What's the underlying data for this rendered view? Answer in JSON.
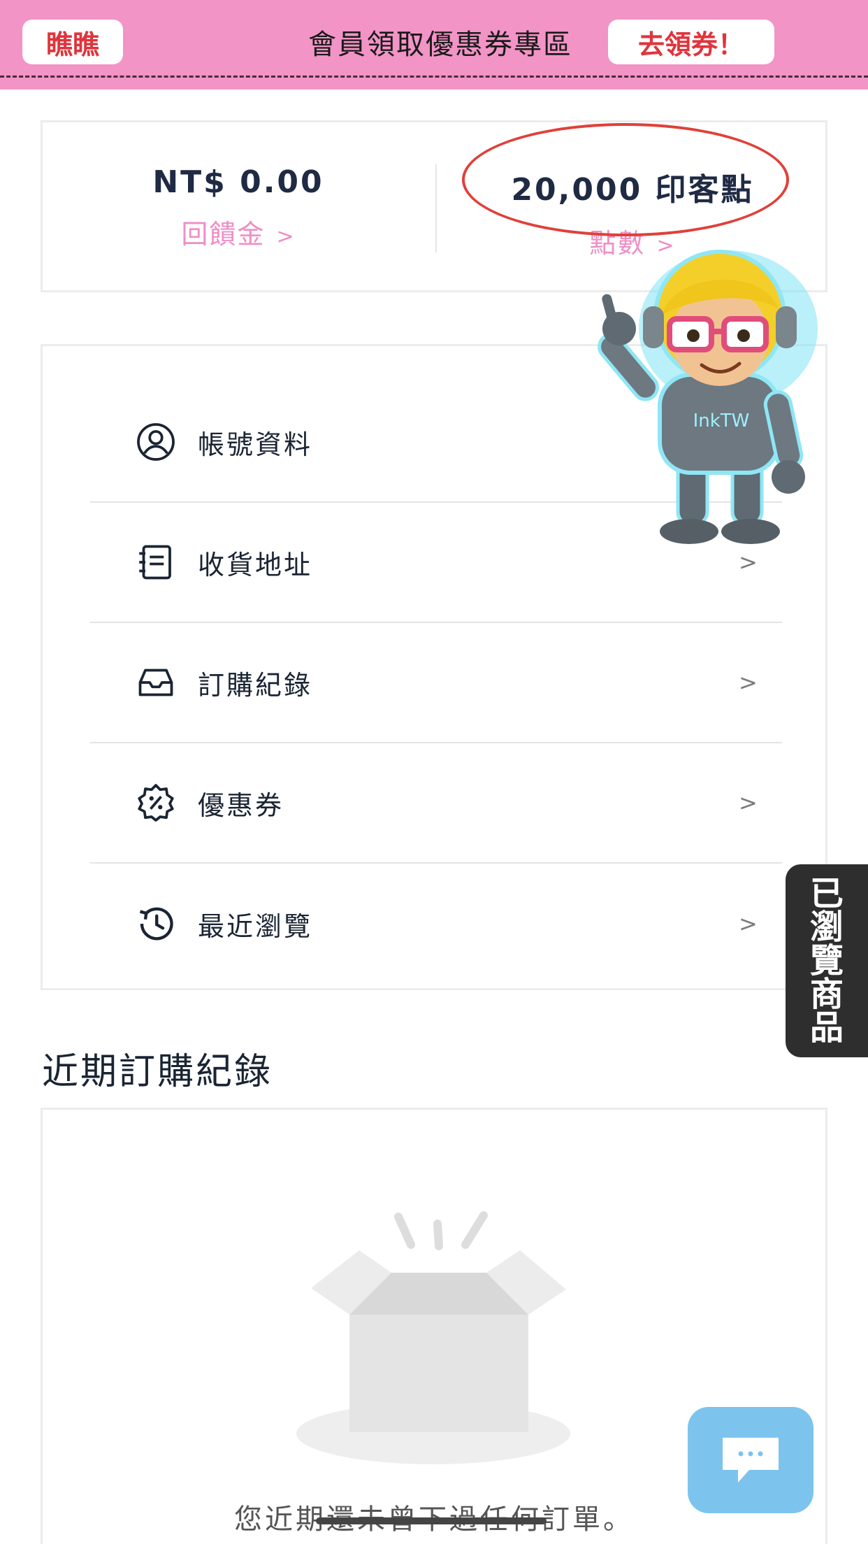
{
  "banner": {
    "left_button": "瞧瞧",
    "title": "會員領取優惠券專區",
    "right_button": "去領券！"
  },
  "balance": {
    "credit_value": "NT$ 0.00",
    "credit_label": "回饋金",
    "points_value": "20,000 印客點",
    "points_label": "點數",
    "chevron": ">"
  },
  "menu": {
    "items": [
      {
        "label": "帳號資料",
        "icon": "user-circle-icon"
      },
      {
        "label": "收貨地址",
        "icon": "address-book-icon"
      },
      {
        "label": "訂購紀錄",
        "icon": "inbox-tray-icon"
      },
      {
        "label": "優惠券",
        "icon": "discount-badge-icon"
      },
      {
        "label": "最近瀏覽",
        "icon": "history-clock-icon"
      }
    ],
    "chevron": ">"
  },
  "recent_orders": {
    "title": "近期訂購紀錄",
    "empty_message": "您近期還未曾下過任何訂單。"
  },
  "side_tab": {
    "label": "已瀏覽商品"
  },
  "mascot": {
    "shirt_text": "InkTW"
  },
  "colors": {
    "banner_bg": "#f294c6",
    "accent_red": "#e0343c",
    "label_pink": "#f08ec6",
    "chat_blue": "#7cc4ee"
  }
}
